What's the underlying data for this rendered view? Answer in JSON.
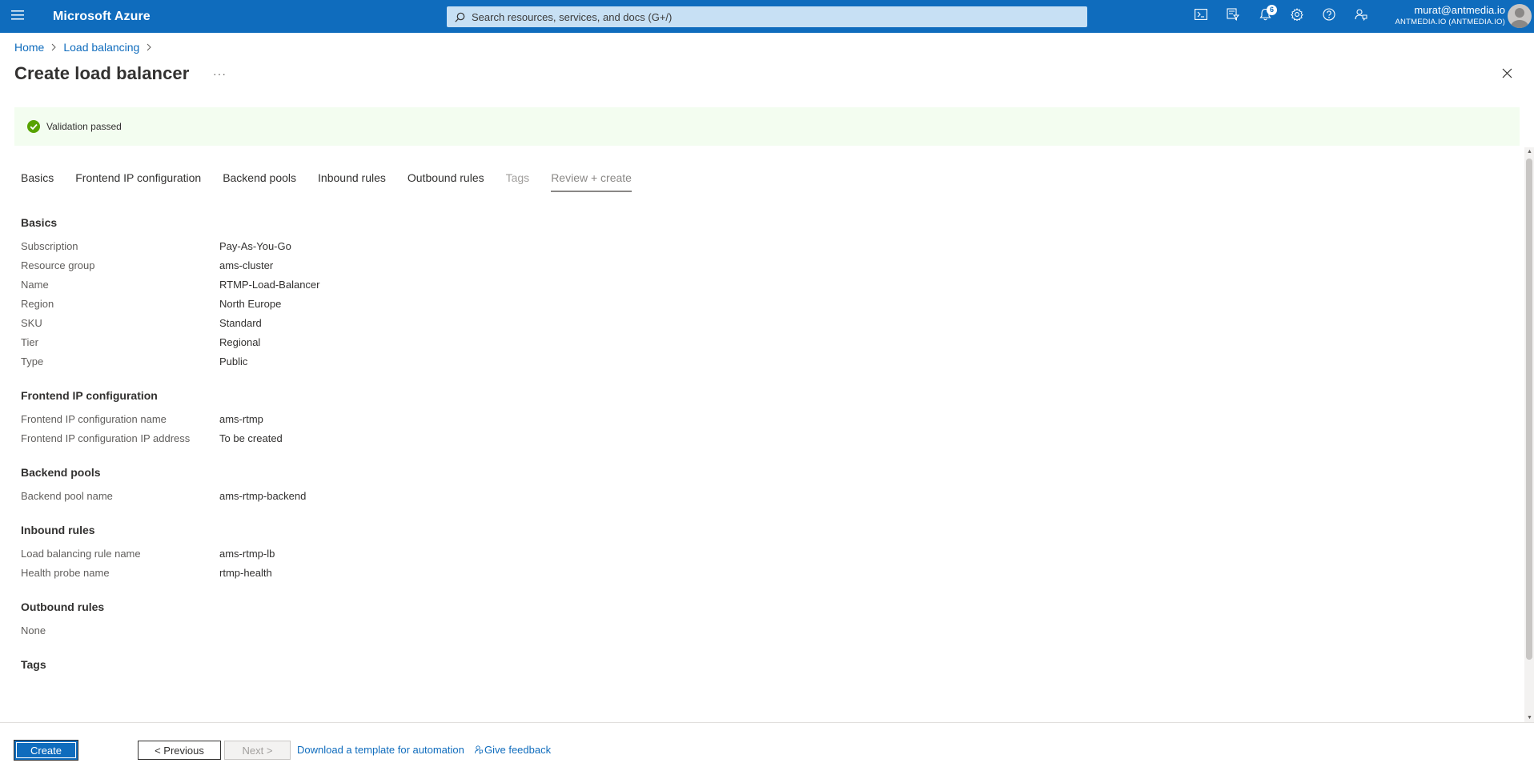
{
  "header": {
    "brand": "Microsoft Azure",
    "search_placeholder": "Search resources, services, and docs (G+/)",
    "notification_count": "6",
    "account_email": "murat@antmedia.io",
    "account_tenant": "ANTMEDIA.IO (ANTMEDIA.IO)"
  },
  "breadcrumb": {
    "home": "Home",
    "load_balancing": "Load balancing"
  },
  "page": {
    "title": "Create load balancer",
    "more": "···"
  },
  "banner": {
    "text": "Validation passed"
  },
  "tabs": [
    {
      "label": "Basics",
      "state": "normal"
    },
    {
      "label": "Frontend IP configuration",
      "state": "normal"
    },
    {
      "label": "Backend pools",
      "state": "normal"
    },
    {
      "label": "Inbound rules",
      "state": "normal"
    },
    {
      "label": "Outbound rules",
      "state": "normal"
    },
    {
      "label": "Tags",
      "state": "disabled"
    },
    {
      "label": "Review + create",
      "state": "active"
    }
  ],
  "sections": {
    "basics": {
      "title": "Basics",
      "rows": [
        {
          "k": "Subscription",
          "v": "Pay-As-You-Go"
        },
        {
          "k": "Resource group",
          "v": "ams-cluster"
        },
        {
          "k": "Name",
          "v": "RTMP-Load-Balancer"
        },
        {
          "k": "Region",
          "v": "North Europe"
        },
        {
          "k": "SKU",
          "v": "Standard"
        },
        {
          "k": "Tier",
          "v": "Regional"
        },
        {
          "k": "Type",
          "v": "Public"
        }
      ]
    },
    "frontend": {
      "title": "Frontend IP configuration",
      "rows": [
        {
          "k": "Frontend IP configuration name",
          "v": "ams-rtmp"
        },
        {
          "k": "Frontend IP configuration IP address",
          "v": "To be created"
        }
      ]
    },
    "backend": {
      "title": "Backend pools",
      "rows": [
        {
          "k": "Backend pool name",
          "v": "ams-rtmp-backend"
        }
      ]
    },
    "inbound": {
      "title": "Inbound rules",
      "rows": [
        {
          "k": "Load balancing rule name",
          "v": "ams-rtmp-lb"
        },
        {
          "k": "Health probe name",
          "v": "rtmp-health"
        }
      ]
    },
    "outbound": {
      "title": "Outbound rules",
      "none": "None"
    },
    "tags": {
      "title": "Tags"
    }
  },
  "footer": {
    "create": "Create",
    "previous": "< Previous",
    "next": "Next >",
    "template_link": "Download a template for automation",
    "feedback_link": "Give feedback"
  },
  "colors": {
    "brand_blue": "#0f6cbd",
    "success_green": "#57a300",
    "banner_bg": "#f3fdf0"
  }
}
